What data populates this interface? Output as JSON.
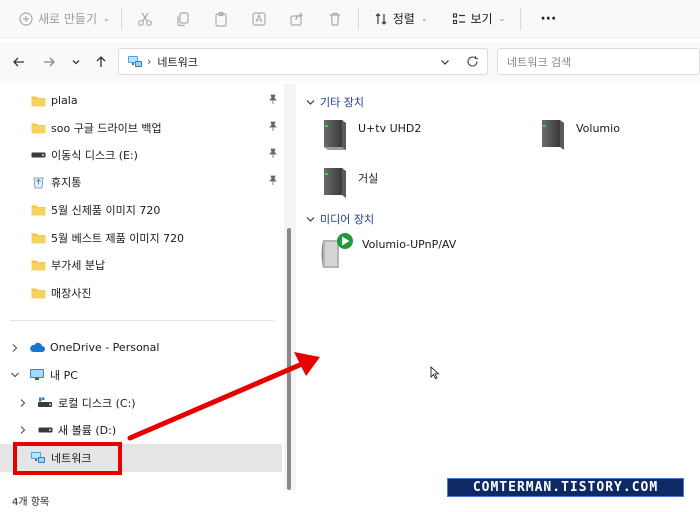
{
  "toolbar": {
    "new_label": "새로 만들기",
    "sort_label": "정렬",
    "view_label": "보기",
    "more_label": "···"
  },
  "address": {
    "crumb": "네트워크",
    "search_placeholder": "네트워크 검색"
  },
  "nav_pane": {
    "quick_access": [
      {
        "label": "plala",
        "icon": "folder-icon",
        "pinned": true
      },
      {
        "label": "soo 구글 드라이브 백업",
        "icon": "folder-icon",
        "pinned": true
      },
      {
        "label": "이동식 디스크 (E:)",
        "icon": "drive-icon",
        "pinned": true
      },
      {
        "label": "휴지통",
        "icon": "recycle-bin-icon",
        "pinned": true
      },
      {
        "label": "5월 신제품 이미지 720",
        "icon": "folder-icon",
        "pinned": false
      },
      {
        "label": "5월 베스트 제품 이미지 720",
        "icon": "folder-icon",
        "pinned": false
      },
      {
        "label": "부가세 분납",
        "icon": "folder-icon",
        "pinned": false
      },
      {
        "label": "매장사진",
        "icon": "folder-icon",
        "pinned": false
      }
    ],
    "onedrive": "OneDrive - Personal",
    "this_pc": "내 PC",
    "local_disk": "로컬 디스크 (C:)",
    "new_volume": "새 볼륨 (D:)",
    "network": "네트워크"
  },
  "content": {
    "other_devices_header": "기타 장치",
    "media_devices_header": "미디어 장치",
    "other_devices": [
      "U+tv UHD2",
      "Volumio",
      "거실"
    ],
    "media_devices": [
      "Volumio-UPnP/AV"
    ]
  },
  "status": {
    "item_count": "4개 항목"
  },
  "watermark": "COMTERMAN.TISTORY.COM",
  "colors": {
    "accent_blue": "#1f3f8a",
    "annotation_red": "#e60000",
    "selected_bg": "#e5e5e5"
  }
}
